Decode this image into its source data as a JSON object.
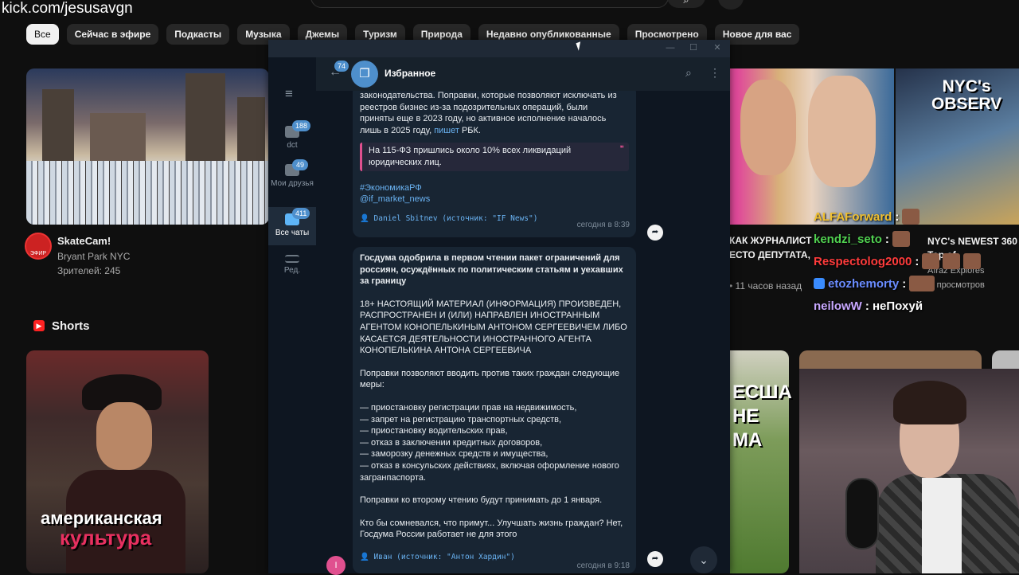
{
  "watermark": "kick.com/jesusavgn",
  "youtube": {
    "chips": [
      "Все",
      "Сейчас в эфире",
      "Подкасты",
      "Музыка",
      "Джемы",
      "Туризм",
      "Природа",
      "Недавно опубликованные",
      "Просмотрено",
      "Новое для вас"
    ],
    "live_video": {
      "title": "SkateCam!",
      "channel": "Bryant Park NYC",
      "viewers": "Зрителей: 245",
      "badge": "ЭФИР"
    },
    "shorts_title": "Shorts",
    "short1_caption_line1": "американская",
    "short1_caption_line2": "культура",
    "right_video1": {
      "title_line1": "КАК ЖУРНАЛИСТ",
      "title_line2": "ЕСТО ДЕПУТАТА,",
      "time": "• 11 часов назад"
    },
    "right_video2": {
      "thumb_text_line1": "NYC's",
      "thumb_text_line2": "OBSERV",
      "title_line1": "NYC's NEWEST 360",
      "title_line2": "Top of",
      "channel": "Afraz Explores",
      "views": "с. просмотров"
    },
    "short_r1_caption": [
      "ЕСША",
      "НЕ",
      "МА"
    ]
  },
  "stream_chat": [
    {
      "user": "ALFAForward",
      "color": "#f0c030",
      "message": ":"
    },
    {
      "user": "kendzi_seto",
      "color": "#50d050",
      "message": ":"
    },
    {
      "user": "Respectolog2000",
      "color": "#ff3b3b",
      "message": ":"
    },
    {
      "user": "etozhemorty",
      "color": "#6a8cff",
      "message": ":"
    },
    {
      "user": "neilowW",
      "color": "#c8a8ff",
      "message": ": неПохуй"
    }
  ],
  "telegram": {
    "window_buttons": [
      "—",
      "☐",
      "✕"
    ],
    "folders": [
      {
        "label": "dct",
        "badge": "188"
      },
      {
        "label": "Мои друзья",
        "badge": "49"
      },
      {
        "label": "Все чаты",
        "badge": "411"
      },
      {
        "label": "Ред.",
        "badge": ""
      }
    ],
    "back_badge": "74",
    "chat_title": "Избранное",
    "messages": [
      {
        "text_lines": [
          "законодательства. Поправки, которые позволяют исключать из",
          "реестров бизнес из-за подозрительных операций, были",
          "приняты еще в 2023 году, но активное исполнение началось",
          "лишь в 2025 году,"
        ],
        "link": "пишет",
        "after_link": " РБК.",
        "quote": "На 115-ФЗ пришлись около 10% всех ликвидаций юридических лиц.",
        "hashtag": "#ЭкономикаРФ",
        "mention": "@if_market_news",
        "signature": "👤 Daniel Sbitnev (источник: \"IF News\")",
        "time": "сегодня в 8:39"
      },
      {
        "title": "Госдума одобрила в первом чтении пакет ограничений для россиян, осуждённых по политическим статьям и уехавших за границу",
        "disclaimer": "18+ НАСТОЯЩИЙ МАТЕРИАЛ (ИНФОРМАЦИЯ) ПРОИЗВЕДЕН, РАСПРОСТРАНЕН И (ИЛИ) НАПРАВЛЕН ИНОСТРАННЫМ АГЕНТОМ КОНОПЕЛЬКИНЫМ АНТОНОМ СЕРГЕЕВИЧЕМ ЛИБО КАСАЕТСЯ ДЕЯТЕЛЬНОСТИ ИНОСТРАННОГО АГЕНТА КОНОПЕЛЬКИНА АНТОНА СЕРГЕЕВИЧА",
        "intro": "Поправки позволяют вводить против таких граждан следующие меры:",
        "items": [
          "— приостановку регистрации прав на недвижимость,",
          "— запрет на регистрацию транспортных средств,",
          "— приостановку водительских прав,",
          "— отказ в заключении кредитных договоров,",
          "— заморозку денежных средств и имущества,",
          "— отказ в консульских действиях, включая оформление нового загранпаспорта."
        ],
        "second_reading": "Поправки ко второму чтению будут принимать до 1 января.",
        "comment": "Кто бы сомневался, что примут... Улучшать жизнь граждан? Нет, Госдума России работает не для этого",
        "signature": "👤 Иван (источник: \"Антон Хардин\")",
        "time": "сегодня в 9:18"
      }
    ]
  },
  "icons": {
    "search": "⌕",
    "more": "⋮",
    "forward": "➦",
    "chevron_down": "⌄",
    "hamburger": "≡",
    "back": "←"
  }
}
